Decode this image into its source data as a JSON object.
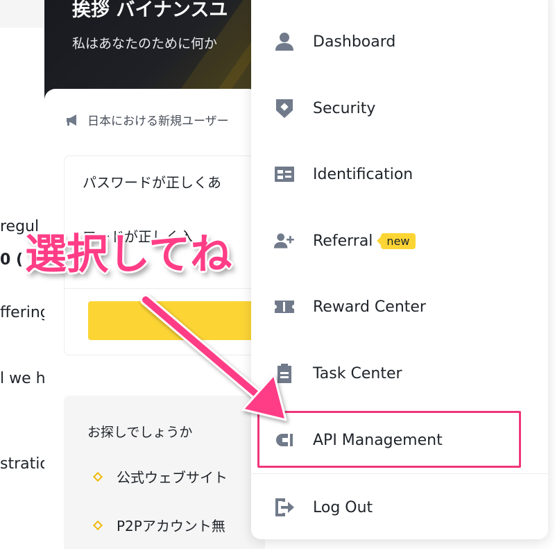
{
  "hero": {
    "title": "挨拶 バイナンスユ",
    "subtitle": "私はあなたのために何か"
  },
  "notice": {
    "text": "日本における新規ユーザー"
  },
  "password_card": {
    "line1": "パスワードが正しくあ",
    "line2": "ワードが正しく入"
  },
  "help": {
    "title": "お探しでしょうか",
    "items": [
      "公式ウェブサイト",
      "P2Pアカウント無"
    ]
  },
  "left_fragments": [
    "regul",
    "0 (",
    "ffering",
    "l we h",
    "stratio"
  ],
  "menu": {
    "items": [
      {
        "label": "Dashboard",
        "icon": "user-icon"
      },
      {
        "label": "Security",
        "icon": "shield-icon"
      },
      {
        "label": "Identification",
        "icon": "id-card-icon"
      },
      {
        "label": "Referral",
        "icon": "add-user-icon",
        "badge": "new"
      },
      {
        "label": "Reward Center",
        "icon": "ticket-icon"
      },
      {
        "label": "Task Center",
        "icon": "clipboard-icon"
      },
      {
        "label": "API Management",
        "icon": "plug-icon"
      },
      {
        "label": "Log Out",
        "icon": "logout-icon"
      }
    ]
  },
  "annotation": {
    "text": "選択してね"
  },
  "colors": {
    "accent_yellow": "#fcd535",
    "highlight_pink": "#f0357a",
    "annotation_pink": "#ff3d86",
    "icon_gray": "#707a8a"
  }
}
